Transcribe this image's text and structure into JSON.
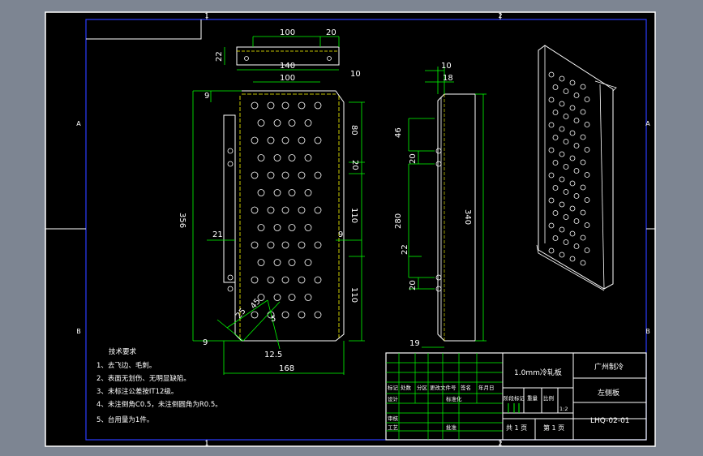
{
  "border": {
    "zone_numbers_top": [
      "1",
      "2"
    ],
    "zone_numbers_bottom": [
      "1",
      "2"
    ],
    "zone_letters_left": [
      "A",
      "B"
    ],
    "zone_letters_right": [
      "A",
      "B"
    ]
  },
  "front_view": {
    "dimensions": {
      "top_100": "100",
      "top_20": "20",
      "flange_22": "22",
      "right_10": "10",
      "width_140": "140",
      "width_100": "100",
      "left_9": "9",
      "height_356": "356",
      "left_21": "21",
      "right_9": "9",
      "right_80": "80",
      "right_20": "20",
      "right_110_upper": "110",
      "right_110_lower": "110",
      "angle_25": "25",
      "angle_45": "45",
      "angle_5": "5",
      "small_12_5": "12.5",
      "bottom_9": "9",
      "bottom_168": "168"
    }
  },
  "side_view": {
    "dimensions": {
      "top_10": "10",
      "top_18": "18",
      "left_46": "46",
      "left_20_upper": "20",
      "left_280": "280",
      "left_22": "22",
      "left_20_lower": "20",
      "right_340": "340",
      "bottom_19": "19"
    }
  },
  "tech_notes": {
    "title": "技术要求",
    "items": [
      "1、去飞边、毛刺。",
      "2、表面无划伤、无明显缺陷。",
      "3、未标注公差按IT12级。",
      "4、未注倒角C0.5，未注倒圆角为R0.5。",
      "5、台用量为1件。"
    ]
  },
  "title_block": {
    "material": "1.0mm冷轧板",
    "company": "广州制冷",
    "part_name": "左侧板",
    "drawing_no": "LHQ-02-01",
    "sheet_total": "共 1 页",
    "sheet_current": "第 1 页",
    "scale_ratio": "1:2",
    "rev_headers": [
      "标记",
      "处数",
      "分区",
      "更改文件号",
      "签名",
      "年月日"
    ],
    "role_designer": "设计",
    "role_standard": "标准化",
    "role_checker": "审核",
    "role_process": "工艺",
    "role_approve": "批准",
    "stage_label": "阶段标记",
    "weight_label": "重量",
    "scale_label": "比例"
  }
}
